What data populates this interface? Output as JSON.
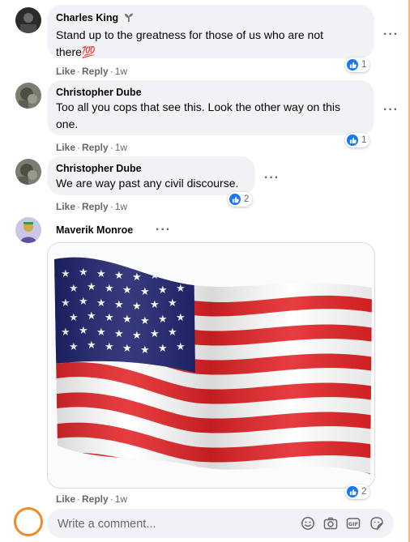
{
  "comments": [
    {
      "author": "Charles King",
      "text": "Stand up to the greatness for those of us who are not there💯",
      "like": "Like",
      "reply": "Reply",
      "time": "1w",
      "reactions": "1"
    },
    {
      "author": "Christopher Dube",
      "text": "Too all you cops that see this. Look the other way on this one.",
      "like": "Like",
      "reply": "Reply",
      "time": "1w",
      "reactions": "1"
    },
    {
      "author": "Christopher Dube",
      "text": "We are way past any civil discourse.",
      "like": "Like",
      "reply": "Reply",
      "time": "1w",
      "reactions": "2"
    },
    {
      "author": "Maverik Monroe",
      "like": "Like",
      "reply": "Reply",
      "time": "1w",
      "reactions": "2",
      "attachment": "american-flag-gif"
    }
  ],
  "composer": {
    "placeholder": "Write a comment..."
  },
  "icons": {
    "more": "more-horizontal-icon",
    "like_reaction": "thumbs-up-icon",
    "composer": [
      "emoji-icon",
      "camera-icon",
      "gif-icon",
      "sticker-icon"
    ],
    "author_badge": "plant-badge-icon"
  },
  "colors": {
    "bubble": "#f0f2f5",
    "like_blue": "#1877f2",
    "meta_gray": "#65676b",
    "flag_red": "#e32326",
    "flag_blue": "#1b1f6b",
    "highlight_orange": "#f08a2a"
  }
}
